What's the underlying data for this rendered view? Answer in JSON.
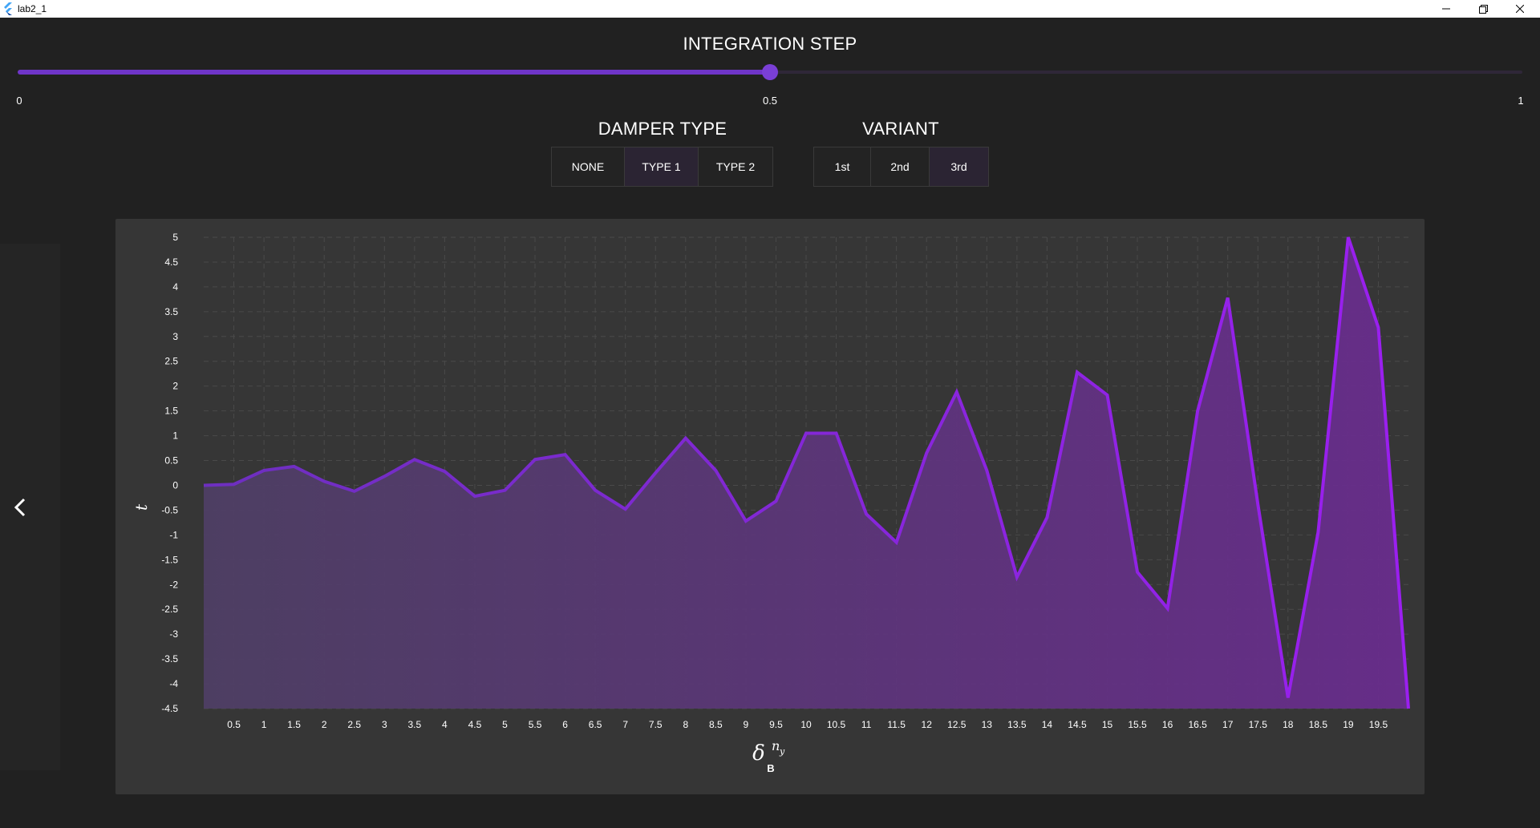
{
  "window": {
    "title": "lab2_1"
  },
  "integration_step": {
    "title": "INTEGRATION STEP",
    "value": 0.5,
    "min": 0,
    "max": 1,
    "labels": [
      "0",
      "0.5",
      "1"
    ],
    "accent": "#7a3fd6"
  },
  "damper": {
    "title": "DAMPER TYPE",
    "options": [
      "NONE",
      "TYPE 1",
      "TYPE 2"
    ],
    "selected": "TYPE 1"
  },
  "variant": {
    "title": "VARIANT",
    "options": [
      "1st",
      "2nd",
      "3rd"
    ],
    "selected": "3rd"
  },
  "nav": {
    "back_icon": "chevron-left-icon"
  },
  "chart_data": {
    "type": "area",
    "xlabel": "δ^{n_y} B",
    "ylabel": "t",
    "xlim": [
      0,
      20
    ],
    "ylim": [
      -4.5,
      5
    ],
    "x_ticks": [
      0.5,
      1,
      1.5,
      2,
      2.5,
      3,
      3.5,
      4,
      4.5,
      5,
      5.5,
      6,
      6.5,
      7,
      7.5,
      8,
      8.5,
      9,
      9.5,
      10,
      10.5,
      11,
      11.5,
      12,
      12.5,
      13,
      13.5,
      14,
      14.5,
      15,
      15.5,
      16,
      16.5,
      17,
      17.5,
      18,
      18.5,
      19,
      19.5
    ],
    "y_ticks": [
      5,
      4.5,
      4,
      3.5,
      3,
      2.5,
      2,
      1.5,
      1,
      0.5,
      0,
      -0.5,
      -1,
      -1.5,
      -2,
      -2.5,
      -3,
      -3.5,
      -4,
      -4.5
    ],
    "grid": true,
    "line_color_start": "#6d2fbf",
    "line_color_end": "#9b1ff0",
    "x": [
      0,
      0.5,
      1,
      1.5,
      2,
      2.5,
      3,
      3.5,
      4,
      4.5,
      5,
      5.5,
      6,
      6.5,
      7,
      7.5,
      8,
      8.5,
      9,
      9.5,
      10,
      10.5,
      11,
      11.5,
      12,
      12.5,
      13,
      13.5,
      14,
      14.5,
      15,
      15.5,
      16,
      16.5,
      17,
      17.5,
      18,
      18.5,
      19,
      19.5,
      20
    ],
    "y": [
      0,
      0.02,
      0.3,
      0.38,
      0.08,
      -0.12,
      0.18,
      0.52,
      0.28,
      -0.22,
      -0.1,
      0.52,
      0.62,
      -0.1,
      -0.48,
      0.25,
      0.95,
      0.3,
      -0.72,
      -0.32,
      1.05,
      1.05,
      -0.58,
      -1.15,
      0.65,
      1.88,
      0.3,
      -1.85,
      -0.65,
      2.28,
      1.82,
      -1.75,
      -2.48,
      1.5,
      3.78,
      -0.38,
      -4.28,
      -0.95,
      5.0,
      3.18,
      -4.5
    ]
  }
}
